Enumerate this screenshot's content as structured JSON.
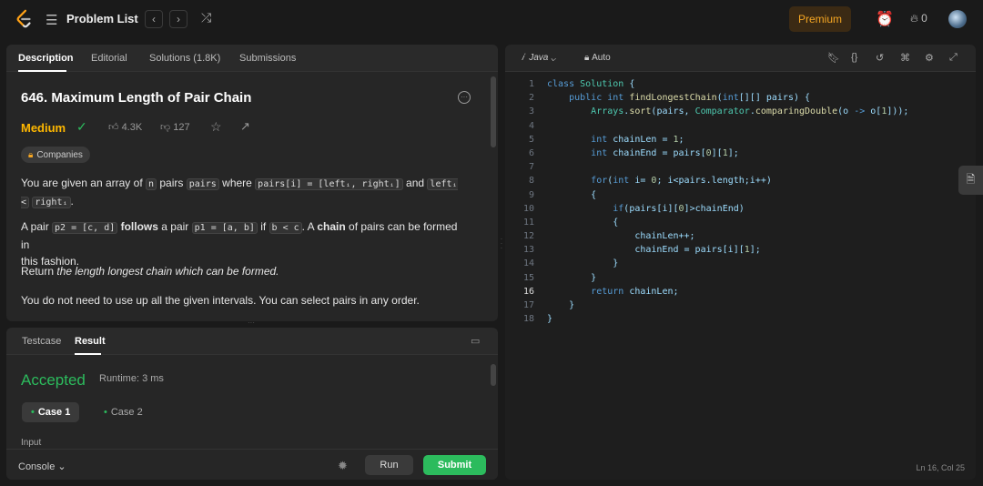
{
  "topbar": {
    "problem_list": "Problem List",
    "premium": "Premium",
    "streak_count": "0"
  },
  "desc_tabs": [
    "Description",
    "Editorial",
    "Solutions (1.8K)",
    "Submissions"
  ],
  "problem": {
    "title": "646. Maximum Length of Pair Chain",
    "difficulty": "Medium",
    "likes": "4.3K",
    "dislikes": "127",
    "companies": "Companies",
    "p1_a": "You are given an array of ",
    "p1_code1": "n",
    "p1_b": " pairs ",
    "p1_code2": "pairs",
    "p1_c": " where ",
    "p1_code3": "pairs[i] = [leftᵢ, rightᵢ]",
    "p1_d": " and ",
    "p1_code4": "leftᵢ <",
    "p1_code5": "rightᵢ",
    "p1_e": ".",
    "p2_a": "A pair ",
    "p2_code1": "p2 = [c, d]",
    "p2_bold1": "follows",
    "p2_b": " a pair ",
    "p2_code2": "p1 = [a, b]",
    "p2_c": " if ",
    "p2_code3": "b < c",
    "p2_d": ". A ",
    "p2_bold2": "chain",
    "p2_e": " of pairs can be formed in",
    "p2_f": "this fashion.",
    "p3_a": "Return ",
    "p3_italic": "the length longest chain which can be formed.",
    "p4": "You do not need to use up all the given intervals. You can select pairs in any order."
  },
  "result_tabs": [
    "Testcase",
    "Result"
  ],
  "result": {
    "status": "Accepted",
    "runtime": "Runtime: 3 ms",
    "case1": "Case 1",
    "case2": "Case 2",
    "input_label": "Input"
  },
  "bottom": {
    "console": "Console",
    "run": "Run",
    "submit": "Submit"
  },
  "editor": {
    "language": "Java",
    "mode": "Auto",
    "cursor": "Ln 16, Col 25",
    "current_line": 16
  },
  "colors": {
    "accepted": "#2cbb5d",
    "medium": "#ffb800",
    "premium": "#f5a623"
  }
}
